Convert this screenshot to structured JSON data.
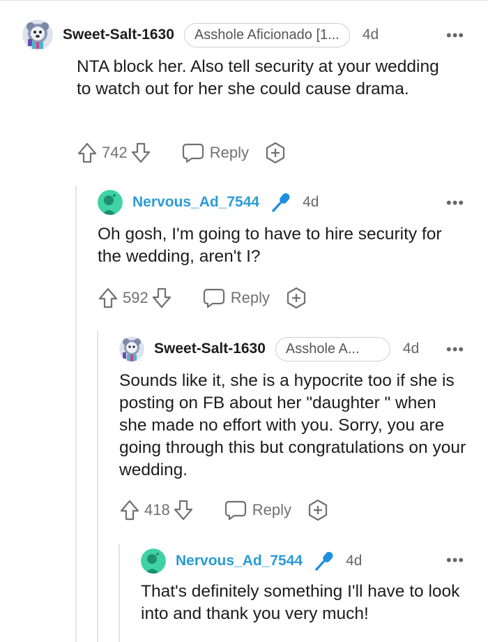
{
  "comments": [
    {
      "username": "Sweet-Salt-1630",
      "flair": "Asshole Aficionado [1...",
      "age": "4d",
      "body": "NTA block her. Also tell security at your wedding to watch out for her she could cause drama.",
      "score": "742",
      "reply_label": "Reply"
    },
    {
      "username": "Nervous_Ad_7544",
      "is_op": true,
      "age": "4d",
      "body": "Oh gosh, I'm going to have to hire security for the wedding, aren't I?",
      "score": "592",
      "reply_label": "Reply"
    },
    {
      "username": "Sweet-Salt-1630",
      "flair": "Asshole A...",
      "age": "4d",
      "body": "Sounds like it, she is a hypocrite too if she is posting on FB about her \"daughter \" when she made no effort with you. Sorry, you are going through this but congratulations on your wedding.",
      "score": "418",
      "reply_label": "Reply"
    },
    {
      "username": "Nervous_Ad_7544",
      "is_op": true,
      "age": "4d",
      "body": "That's definitely something I'll have to look into and thank you very much!"
    }
  ],
  "more_icon": "•••",
  "colors": {
    "op_username": "#2b9bd6",
    "op_avatar": "#3fd3a4",
    "thread_line": "#e4e4e4",
    "mic": "#1d8fe0"
  },
  "icons": [
    "upvote-icon",
    "downvote-icon",
    "reply-icon",
    "award-icon",
    "mic-icon",
    "more-icon"
  ]
}
